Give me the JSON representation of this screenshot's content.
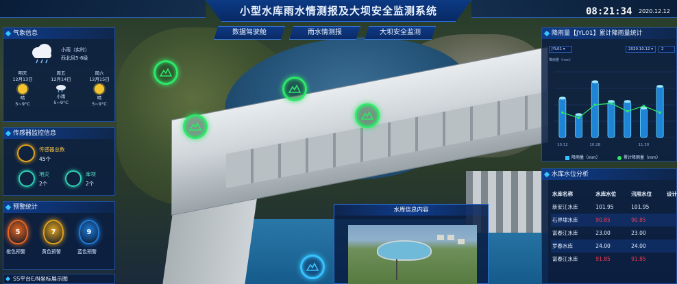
{
  "header": {
    "title": "小型水库雨水情测报及大坝安全监测系统",
    "time": "08:21:34",
    "date": "2020.12.12"
  },
  "nav": {
    "tabs": [
      {
        "label": "数据驾驶舱"
      },
      {
        "label": "雨水情测报"
      },
      {
        "label": "大坝安全监测"
      }
    ]
  },
  "weather": {
    "title": "气象信息",
    "now": {
      "condition": "小雨（实时）",
      "wind": "西北风5-6级",
      "icon": "cloud-rain-icon"
    },
    "days": [
      {
        "name": "明天",
        "date": "12月13日",
        "cond": "晴",
        "temp": "5~9°C",
        "icon": "sun-icon"
      },
      {
        "name": "周五",
        "date": "12月14日",
        "cond": "小雨",
        "temp": "5~9°C",
        "icon": "rain-icon"
      },
      {
        "name": "周六",
        "date": "12月15日",
        "cond": "晴",
        "temp": "5~9°C",
        "icon": "sun-icon"
      }
    ]
  },
  "sensors": {
    "title": "传感器监控信息",
    "total_label": "传感器总数",
    "total": "45个",
    "items": [
      {
        "label": "地灾",
        "count": "2个"
      },
      {
        "label": "库坝",
        "count": "2个"
      }
    ]
  },
  "alarms": {
    "title": "预警统计",
    "items": [
      {
        "value": "5",
        "label": "橙色预警",
        "color": "#e8661e"
      },
      {
        "value": "7",
        "label": "黄色预警",
        "color": "#e0a21c"
      },
      {
        "value": "9",
        "label": "蓝色预警",
        "color": "#1f7ad6"
      }
    ]
  },
  "coords": {
    "title": "SS平台E/N坐标展示图"
  },
  "rainfall": {
    "title": "降雨量【JYL01】累计降雨量统计",
    "select_station": "JYL01",
    "select_date": "2020.10.12",
    "select_to": "2",
    "ylabel": "降雨量（mm）",
    "legend": [
      "降雨量（mm）",
      "累计降雨量（mm）"
    ]
  },
  "chart_data": {
    "type": "bar",
    "categories": [
      "10.12",
      "",
      "10.28",
      "",
      "",
      "11.30",
      ""
    ],
    "series": [
      {
        "name": "降雨量（mm）",
        "values": [
          60,
          35,
          85,
          55,
          55,
          45,
          78
        ]
      },
      {
        "name": "累计降雨量（mm）",
        "values": [
          38,
          30,
          50,
          52,
          40,
          48,
          38
        ]
      }
    ]
  },
  "reservoir_water": {
    "title": "水库水位分析",
    "columns": [
      "水库名称",
      "水库水位",
      "汛限水位",
      "设计"
    ],
    "rows": [
      {
        "name": "新安江水库",
        "level": "101.95",
        "limit": "101.95",
        "red": false
      },
      {
        "name": "石界埭水库",
        "level": "90.85",
        "limit": "90.85",
        "red": true
      },
      {
        "name": "富春江水库",
        "level": "23.00",
        "limit": "23.00",
        "red": false
      },
      {
        "name": "罗春水库",
        "level": "24.00",
        "limit": "24.00",
        "red": false
      },
      {
        "name": "富春江水库",
        "level": "91.85",
        "limit": "91.85",
        "red": true
      }
    ]
  },
  "reservoir_info": {
    "title": "水库信息内容"
  },
  "colors": {
    "accent": "#35c4ff",
    "poi_green": "#2ee86a",
    "alert_red": "#ff3b52"
  }
}
